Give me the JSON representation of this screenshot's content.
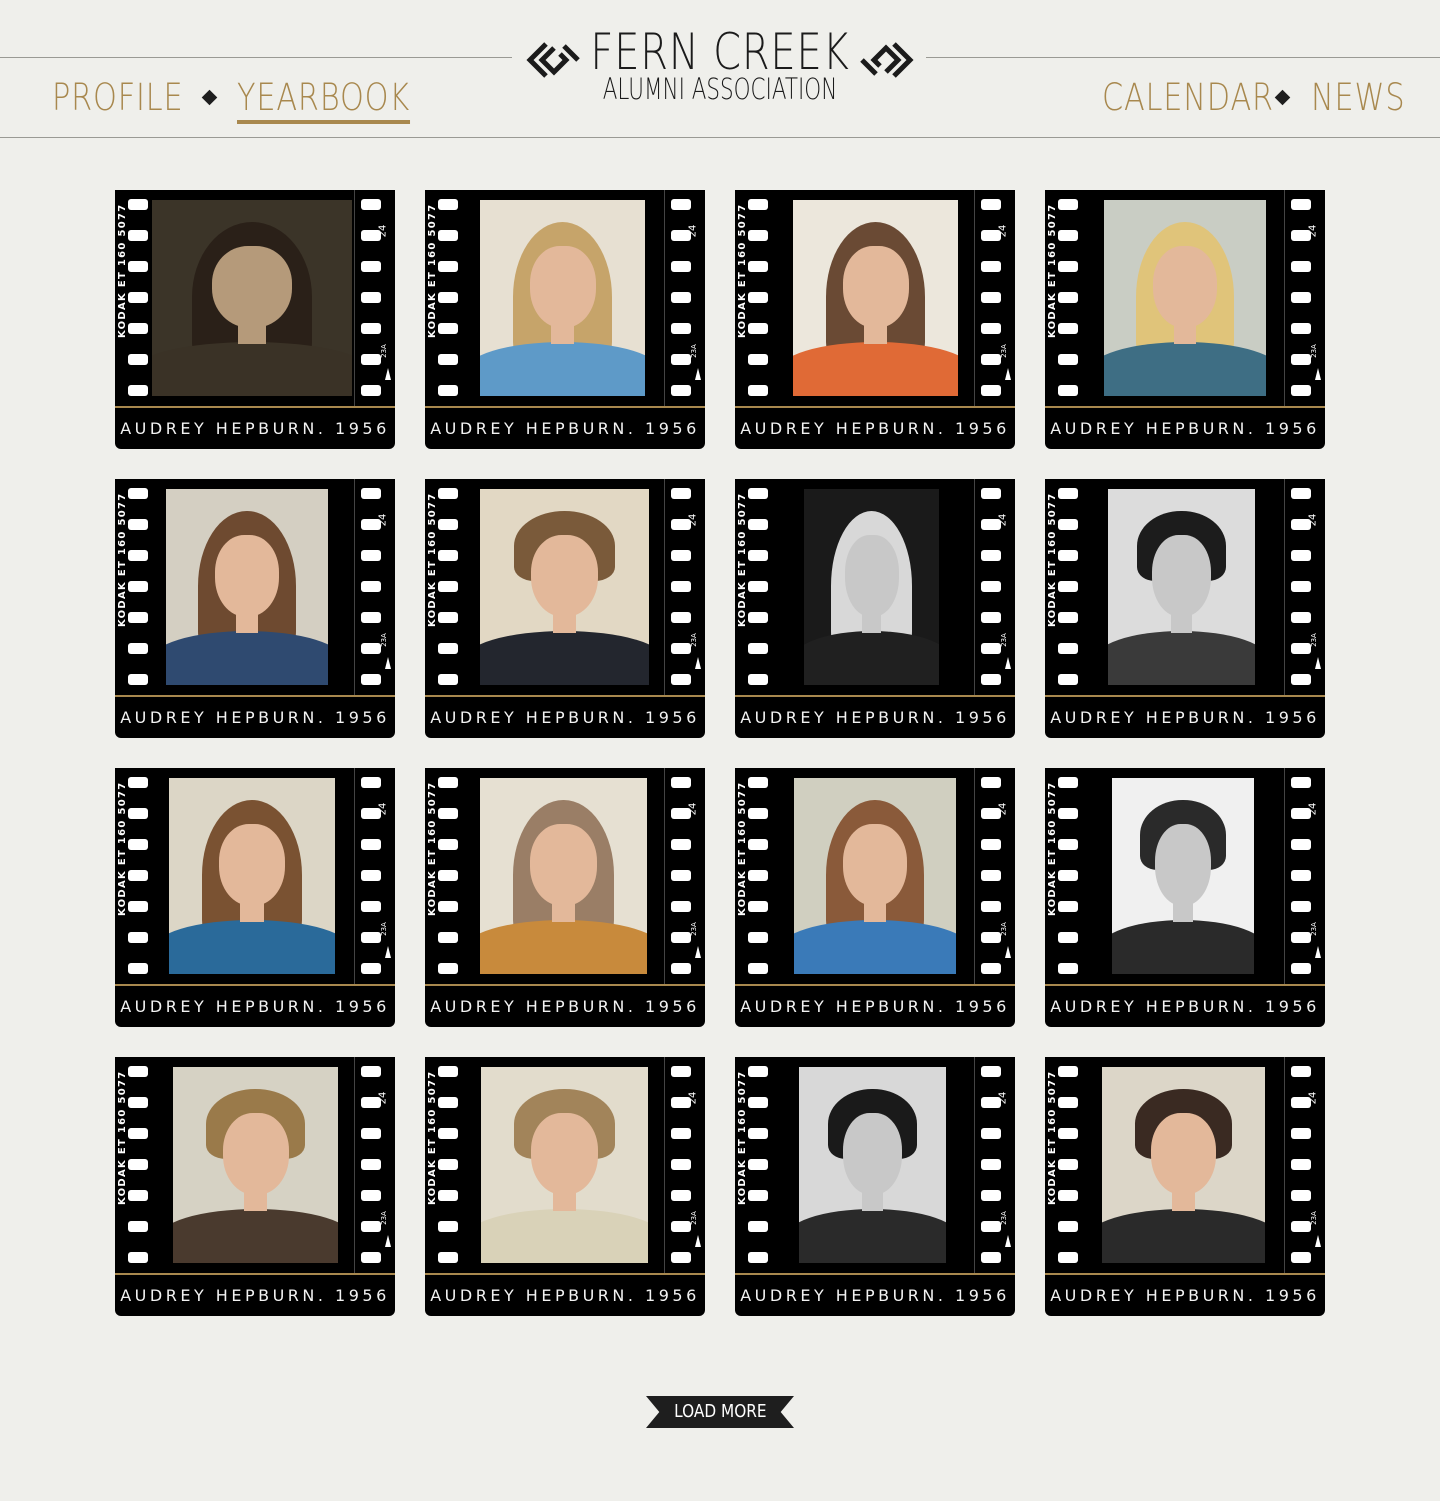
{
  "header": {
    "nav_left": [
      {
        "label": "PROFILE",
        "active": false
      },
      {
        "label": "YEARBOOK",
        "active": true
      }
    ],
    "nav_right": [
      {
        "label": "CALENDAR",
        "active": false
      },
      {
        "label": "NEWS",
        "active": false
      }
    ],
    "logo_title": "FERN CREEK",
    "logo_subtitle": "ALUMNI ASSOCIATION",
    "accent_color": "#a8884e"
  },
  "film": {
    "edge_text": "KODAK ET 160 5077",
    "frame_number": "24",
    "frame_sub": "23A"
  },
  "yearbook": [
    {
      "caption": "AUDREY HEPBURN. 1956",
      "tone": "sepia",
      "hair": "#2a2018",
      "shirt": "#3a3226",
      "bg": "#3b3428"
    },
    {
      "caption": "AUDREY HEPBURN. 1956",
      "tone": "color",
      "hair": "#c6a46a",
      "shirt": "#5e9ac8",
      "bg": "#e7e0d2"
    },
    {
      "caption": "AUDREY HEPBURN. 1956",
      "tone": "color",
      "hair": "#6a4a34",
      "shirt": "#e06a36",
      "bg": "#ece7dc"
    },
    {
      "caption": "AUDREY HEPBURN. 1956",
      "tone": "color",
      "hair": "#e0c47a",
      "shirt": "#3e6e84",
      "bg": "#c9cdc4"
    },
    {
      "caption": "AUDREY HEPBURN. 1956",
      "tone": "color",
      "hair": "#6e4a30",
      "shirt": "#2f4a70",
      "bg": "#d4cfc2"
    },
    {
      "caption": "AUDREY HEPBURN. 1956",
      "tone": "color",
      "hair": "#7a5a3a",
      "shirt": "#23262e",
      "bg": "#e2d8c4"
    },
    {
      "caption": "AUDREY HEPBURN. 1956",
      "tone": "bw",
      "hair": "#d8d8d8",
      "shirt": "#202020",
      "bg": "#1a1a1a"
    },
    {
      "caption": "AUDREY HEPBURN. 1956",
      "tone": "bw",
      "hair": "#1c1c1c",
      "shirt": "#3a3a3a",
      "bg": "#dcdcdc"
    },
    {
      "caption": "AUDREY HEPBURN. 1956",
      "tone": "color",
      "hair": "#7a5232",
      "shirt": "#2a6a9a",
      "bg": "#dcd6c6"
    },
    {
      "caption": "AUDREY HEPBURN. 1956",
      "tone": "color",
      "hair": "#9a7e66",
      "shirt": "#c88a3c",
      "bg": "#e6e0d2"
    },
    {
      "caption": "AUDREY HEPBURN. 1956",
      "tone": "color",
      "hair": "#8a5a3a",
      "shirt": "#3a7ab8",
      "bg": "#d0cfc0"
    },
    {
      "caption": "AUDREY HEPBURN. 1956",
      "tone": "bw",
      "hair": "#2a2a2a",
      "shirt": "#2a2a2a",
      "bg": "#f0f0f0"
    },
    {
      "caption": "AUDREY HEPBURN. 1956",
      "tone": "color",
      "hair": "#9a7a4a",
      "shirt": "#4a3a2e",
      "bg": "#d6d2c4"
    },
    {
      "caption": "AUDREY HEPBURN. 1956",
      "tone": "color",
      "hair": "#a2845a",
      "shirt": "#d9d2b8",
      "bg": "#e2dccc"
    },
    {
      "caption": "AUDREY HEPBURN. 1956",
      "tone": "bw",
      "hair": "#1a1a1a",
      "shirt": "#2a2a2a",
      "bg": "#d8d8d8"
    },
    {
      "caption": "AUDREY HEPBURN. 1956",
      "tone": "color",
      "hair": "#3a2a22",
      "shirt": "#2a2a2a",
      "bg": "#dcd6c8"
    }
  ],
  "load_more_label": "LOAD MORE"
}
